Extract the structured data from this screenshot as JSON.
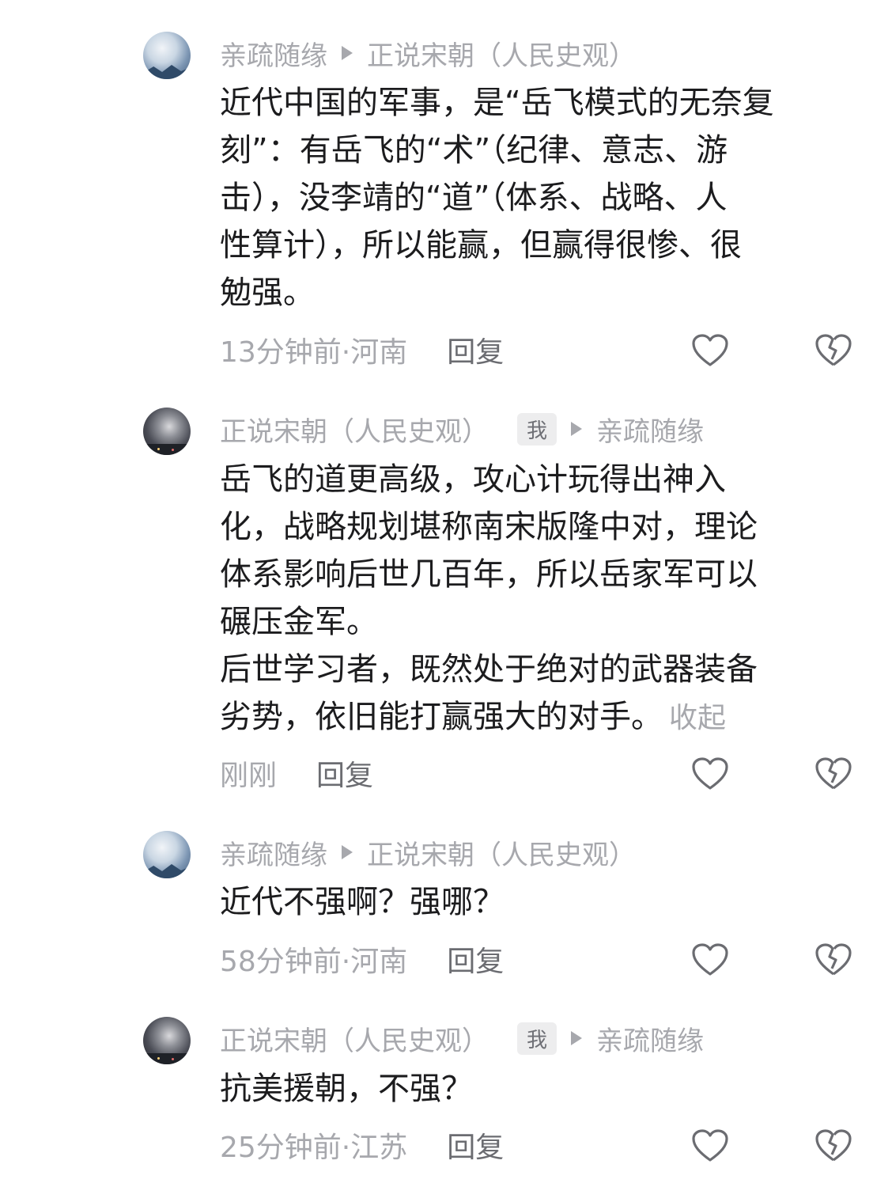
{
  "comments": [
    {
      "author": "亲疏随缘",
      "reply_to": "正说宋朝（人民史观）",
      "badge": "",
      "lines": [
        "近代中国的军事，是“岳飞模式的无奈复",
        "刻”：有岳飞的“术”（纪律、意志、游",
        "击），没李靖的“道”（体系、战略、人",
        "性算计），所以能赢，但赢得很惨、很",
        "勉强。"
      ],
      "time_location": "13分钟前·河南",
      "reply_label": "回复"
    },
    {
      "author": "正说宋朝（人民史观）",
      "badge": "我",
      "reply_to": "亲疏随缘",
      "lines": [
        "岳飞的道更高级，攻心计玩得出神入",
        "化，战略规划堪称南宋版隆中对，理论",
        "体系影响后世几百年，所以岳家军可以",
        "碾压金军。",
        "后世学习者，既然处于绝对的武器装备",
        "劣势，依旧能打赢强大的对手。"
      ],
      "collapse_label": "收起",
      "time_location": "刚刚",
      "reply_label": "回复"
    },
    {
      "author": "亲疏随缘",
      "reply_to": "正说宋朝（人民史观）",
      "badge": "",
      "lines": [
        "近代不强啊？强哪？"
      ],
      "time_location": "58分钟前·河南",
      "reply_label": "回复"
    },
    {
      "author": "正说宋朝（人民史观）",
      "badge": "我",
      "reply_to": "亲疏随缘",
      "lines": [
        "抗美援朝，不强？"
      ],
      "time_location": "25分钟前·江苏",
      "reply_label": "回复"
    }
  ],
  "icons": {
    "like": "heart-outline-icon",
    "dislike": "broken-heart-icon",
    "reply_arrow": "play-triangle-icon"
  },
  "colors": {
    "meta_gray": "#a7a8ad",
    "text": "#1c1c1e",
    "badge_bg": "#ededee"
  }
}
